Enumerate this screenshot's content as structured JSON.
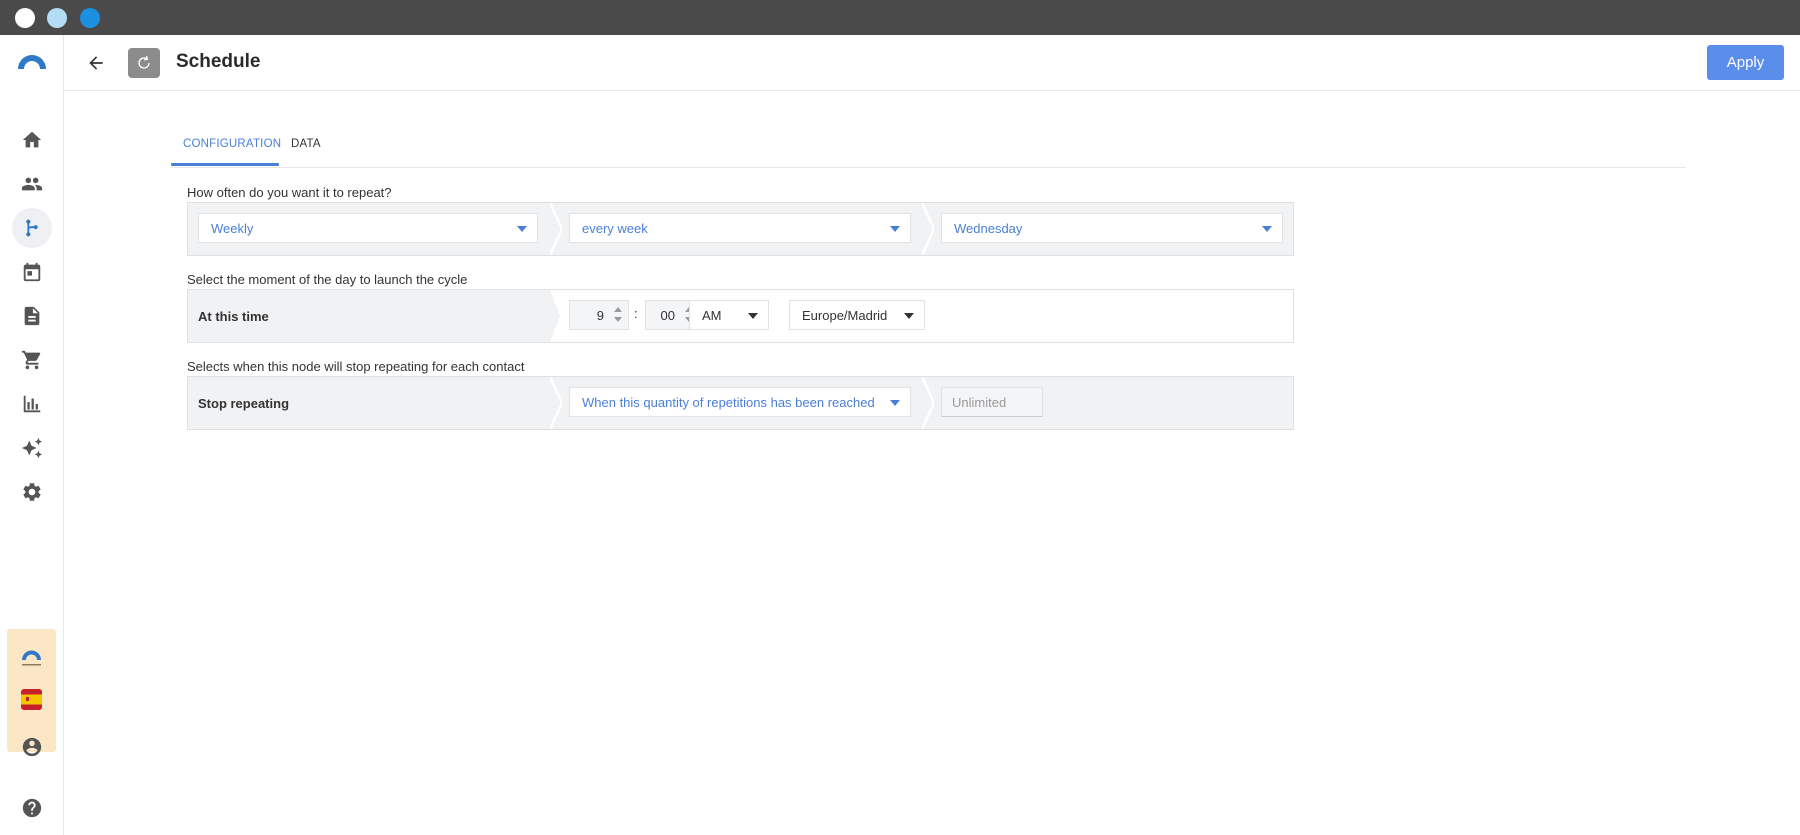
{
  "header": {
    "title": "Schedule",
    "apply_label": "Apply"
  },
  "tabs": [
    {
      "label": "CONFIGURATION",
      "active": true
    },
    {
      "label": "DATA",
      "active": false
    }
  ],
  "repeat": {
    "question": "How often do you want it to repeat?",
    "frequency": "Weekly",
    "interval": "every week",
    "day": "Wednesday"
  },
  "time": {
    "question": "Select the moment of the day to launch the cycle",
    "row_label": "At this time",
    "hour": "9",
    "separator": ":",
    "minute": "00",
    "meridiem": "AM",
    "timezone": "Europe/Madrid"
  },
  "stop": {
    "question": "Selects when this node will stop repeating for each contact",
    "row_label": "Stop repeating",
    "condition": "When this quantity of repetitions has been reached",
    "limit_placeholder": "Unlimited"
  },
  "sidebar": {
    "items": [
      "home-icon",
      "contacts-icon",
      "automation-icon",
      "calendar-icon",
      "document-icon",
      "cart-icon",
      "reports-icon",
      "ai-sparkle-icon",
      "settings-icon"
    ],
    "active_item": "automation-icon"
  },
  "colors": {
    "accent": "#4a7fd8",
    "apply_button": "#5b8dea",
    "account_box": "#fbe6c6"
  }
}
